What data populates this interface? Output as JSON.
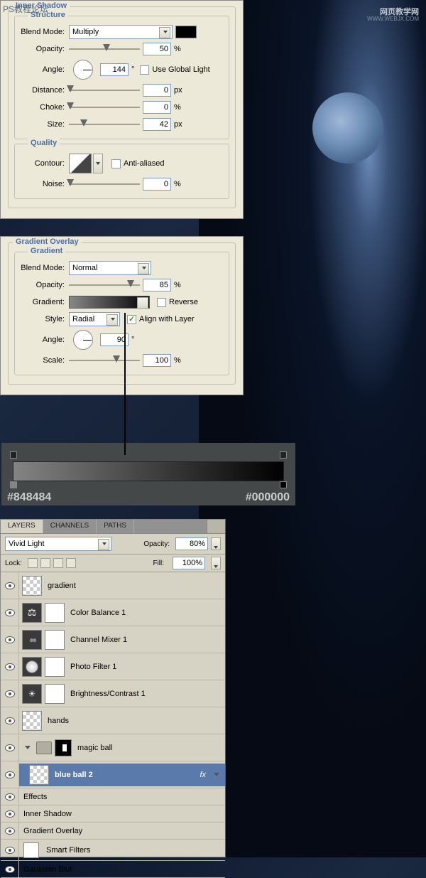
{
  "watermarks": {
    "top_left": "PS教程论坛",
    "top_right": "网页教学网",
    "top_right_url": "WWW.WEBJX.COM"
  },
  "inner_shadow": {
    "title": "Inner Shadow",
    "structure_title": "Structure",
    "quality_title": "Quality",
    "blend_mode_label": "Blend Mode:",
    "blend_mode_value": "Multiply",
    "opacity_label": "Opacity:",
    "opacity_value": "50",
    "angle_label": "Angle:",
    "angle_value": "144",
    "angle_unit": "°",
    "global_light_label": "Use Global Light",
    "distance_label": "Distance:",
    "distance_value": "0",
    "choke_label": "Choke:",
    "choke_value": "0",
    "size_label": "Size:",
    "size_value": "42",
    "contour_label": "Contour:",
    "anti_aliased_label": "Anti-aliased",
    "noise_label": "Noise:",
    "noise_value": "0",
    "px": "px",
    "pct": "%"
  },
  "gradient_overlay": {
    "title": "Gradient Overlay",
    "section_title": "Gradient",
    "blend_mode_label": "Blend Mode:",
    "blend_mode_value": "Normal",
    "opacity_label": "Opacity:",
    "opacity_value": "85",
    "gradient_label": "Gradient:",
    "reverse_label": "Reverse",
    "style_label": "Style:",
    "style_value": "Radial",
    "align_label": "Align with Layer",
    "angle_label": "Angle:",
    "angle_value": "90",
    "angle_unit": "°",
    "scale_label": "Scale:",
    "scale_value": "100",
    "pct": "%"
  },
  "gradient_strip": {
    "left_hex": "#848484",
    "right_hex": "#000000"
  },
  "layers": {
    "tabs": {
      "layers": "LAYERS",
      "channels": "CHANNELS",
      "paths": "PATHS"
    },
    "blend_mode": "Vivid Light",
    "opacity_label": "Opacity:",
    "opacity_value": "80%",
    "lock_label": "Lock:",
    "fill_label": "Fill:",
    "fill_value": "100%",
    "items": [
      {
        "name": "gradient"
      },
      {
        "name": "Color Balance 1"
      },
      {
        "name": "Channel Mixer 1"
      },
      {
        "name": "Photo Filter 1"
      },
      {
        "name": "Brightness/Contrast 1"
      },
      {
        "name": "hands"
      },
      {
        "name": "magic ball"
      },
      {
        "name": "blue ball 2"
      }
    ],
    "fx": "fx",
    "effects_label": "Effects",
    "effect_inner_shadow": "Inner Shadow",
    "effect_gradient_overlay": "Gradient Overlay",
    "smart_filters_label": "Smart Filters",
    "gaussian_blur": "Gaussian Blur"
  }
}
